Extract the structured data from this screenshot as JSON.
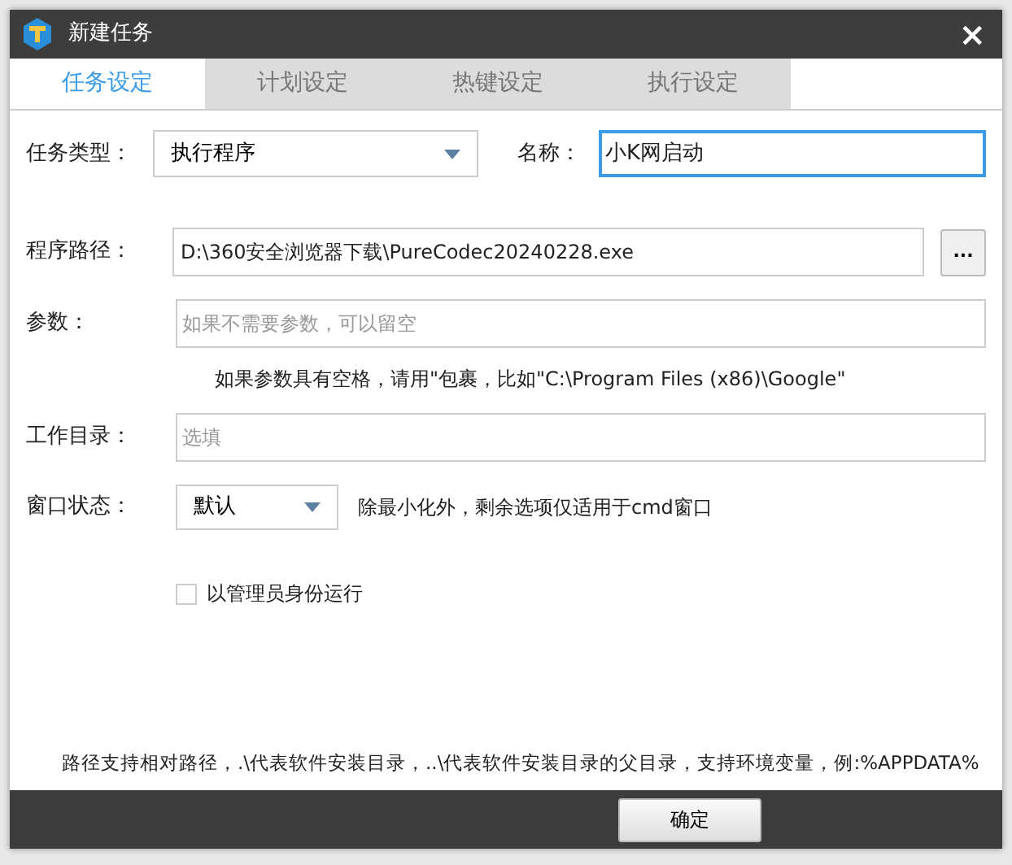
{
  "window": {
    "title": "新建任务",
    "close": "×"
  },
  "tabs": [
    {
      "label": "任务设定",
      "selected": true
    },
    {
      "label": "计划设定",
      "selected": false
    },
    {
      "label": "热键设定",
      "selected": false
    },
    {
      "label": "执行设定",
      "selected": false
    }
  ],
  "task_type": {
    "label": "任务类型：",
    "value": "执行程序"
  },
  "name": {
    "label": "名称：",
    "value": "小K网启动"
  },
  "program_path": {
    "label": "程序路径：",
    "value": "D:\\360安全浏览器下载\\PureCodec20240228.exe",
    "browse": "..."
  },
  "params": {
    "label": "参数：",
    "placeholder": "如果不需要参数，可以留空"
  },
  "params_hint": "如果参数具有空格，请用\"包裹，比如\"C:\\Program Files (x86)\\Google\"",
  "work_dir": {
    "label": "工作目录：",
    "placeholder": "选填"
  },
  "window_state": {
    "label": "窗口状态：",
    "value": "默认",
    "hint": "除最小化外，剩余选项仅适用于cmd窗口"
  },
  "run_as_admin": {
    "label": "以管理员身份运行",
    "checked": false
  },
  "footer_note": "路径支持相对路径，.\\代表软件安装目录，..\\代表软件安装目录的父目录，支持环境变量，例:%APPDATA%",
  "buttons": [
    "确定"
  ]
}
